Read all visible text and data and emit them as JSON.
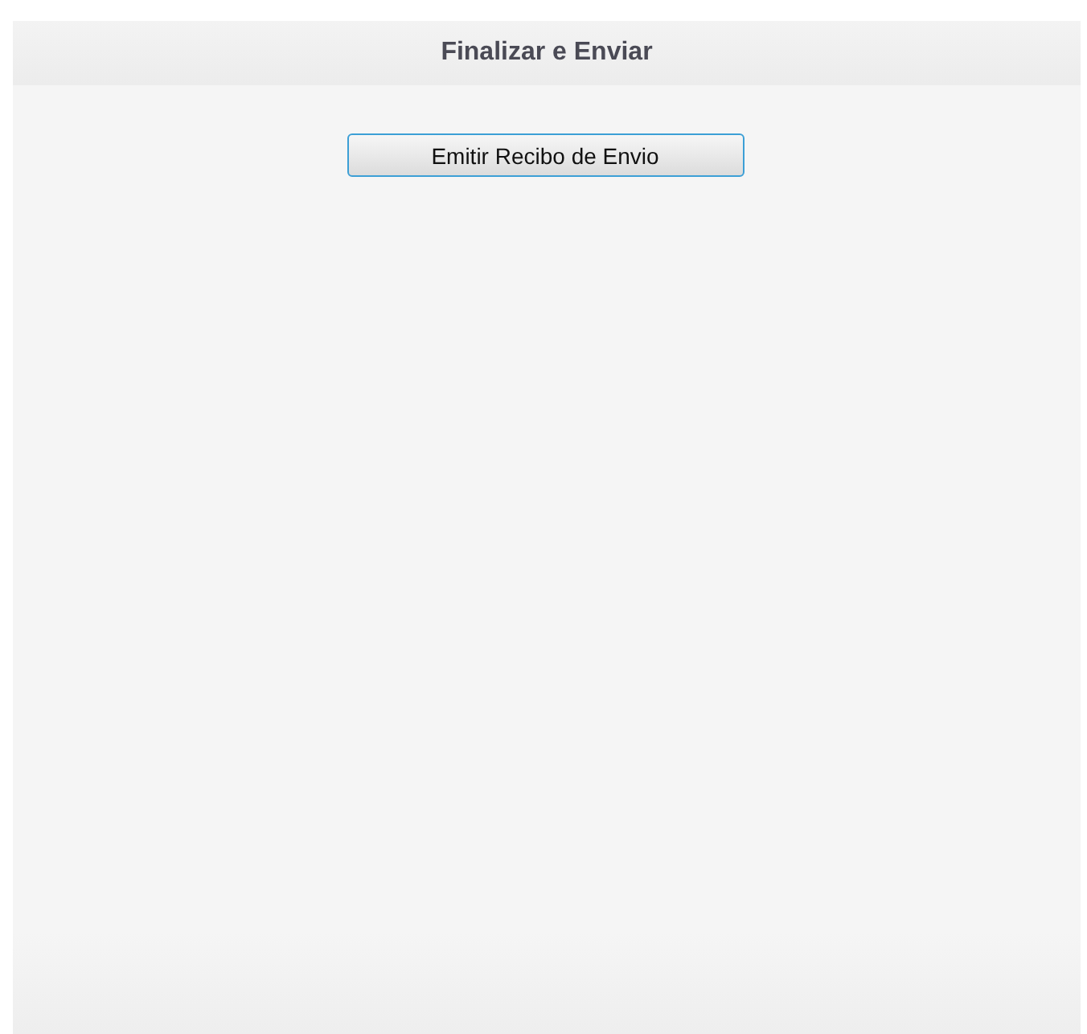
{
  "panel": {
    "title": "Finalizar e Enviar"
  },
  "buttons": [
    "Emitir Recibo de Envio"
  ]
}
